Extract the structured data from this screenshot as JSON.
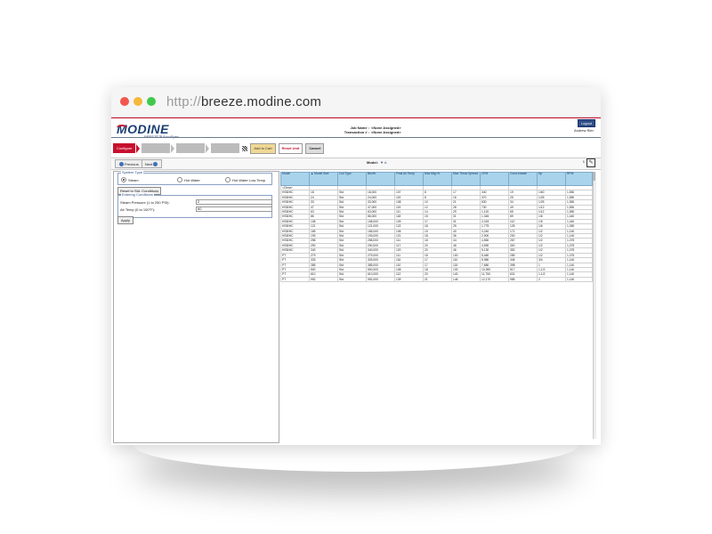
{
  "browser": {
    "url_protocol": "http://",
    "url_host": "breeze.modine.com"
  },
  "brand": {
    "name": "MODINE",
    "product": "BREEZE™ AccuSpec"
  },
  "job": {
    "job_name_label": "Job Name :",
    "job_name_value": "<None Assigned>",
    "transaction_label": "Transaction # :",
    "transaction_value": "<None Assigned>"
  },
  "header": {
    "logout_label": "Logout",
    "user_name": "Andrew Rier"
  },
  "steps": {
    "configure": "Configure",
    "cart": "Add to Cart",
    "reset": "Reset Unit",
    "cancel": "Cancel"
  },
  "nav": {
    "previous": "Previous",
    "next": "Next",
    "model_label": "Model:",
    "model_value": "▼ A",
    "page": "1"
  },
  "system_type": {
    "legend": "System Type",
    "options": [
      "Steam",
      "Hot Water",
      "Hot Water Low Temp"
    ],
    "selected": "Steam"
  },
  "reset_std_label": "Reset to Std. Conditions",
  "entering": {
    "legend": "Entering Conditions",
    "steam_pressure_label": "Steam Pressure (1 to 250 PSI):",
    "steam_pressure_value": "2",
    "air_temp_label": "Air Temp (0 to 100°F):",
    "air_temp_value": "60"
  },
  "apply_label": "Apply",
  "table": {
    "headers": [
      "Model",
      "▲ Model Size",
      "Coil Type",
      "Btu/Hr",
      "Final Air Temp",
      "Max Mtg Ht",
      "Max Throw Spread",
      "CFM",
      "Cond-ensate",
      "Hp",
      "RPM"
    ],
    "clear_label": "<Clear>",
    "rows": [
      [
        "HSB/HC",
        "18",
        "Std",
        "18,000",
        "107",
        "8",
        "17",
        "340",
        "19",
        "1/60",
        "1,550"
      ],
      [
        "HSB/HC",
        "24",
        "Std",
        "24,000",
        "119",
        "8",
        "16",
        "370",
        "25",
        "1/25",
        "1,550"
      ],
      [
        "HSB/HC",
        "33",
        "Std",
        "33,000",
        "108",
        "10",
        "21",
        "630",
        "34",
        "1/25",
        "1,550"
      ],
      [
        "HSB/HC",
        "47",
        "Std",
        "47,000",
        "119",
        "12",
        "28",
        "730",
        "49",
        "1/12",
        "1,550"
      ],
      [
        "HSB/HC",
        "63",
        "Std",
        "63,000",
        "111",
        "14",
        "29",
        "1,120",
        "65",
        "1/12",
        "1,550"
      ],
      [
        "HSB/HC",
        "86",
        "Std",
        "86,000",
        "118",
        "15",
        "31",
        "1,345",
        "89",
        "1/6",
        "1,440"
      ],
      [
        "HSB/HC",
        "108",
        "Std",
        "108,000",
        "109",
        "17",
        "31",
        "2,015",
        "112",
        "1/5",
        "1,440"
      ],
      [
        "HSB/HC",
        "121",
        "Std",
        "121,000",
        "122",
        "18",
        "25",
        "1,775",
        "125",
        "1/6",
        "1,050"
      ],
      [
        "HSB/HC",
        "165",
        "Std",
        "165,000",
        "106",
        "19",
        "40",
        "3,240",
        "171",
        "1/2",
        "1,140"
      ],
      [
        "HSB/HC",
        "193",
        "Std",
        "193,000",
        "121",
        "18",
        "36",
        "2,900",
        "200",
        "1/2",
        "1,140"
      ],
      [
        "HSB/HC",
        "258",
        "Std",
        "258,000",
        "111",
        "18",
        "44",
        "4,560",
        "267",
        "1/2",
        "1,075"
      ],
      [
        "HSB/HC",
        "290",
        "Std",
        "290,000",
        "117",
        "20",
        "46",
        "4,590",
        "300",
        "1/2",
        "1,075"
      ],
      [
        "HSB/HC",
        "340",
        "Std",
        "340,000",
        "120",
        "20",
        "46",
        "5,130",
        "352",
        "1/2",
        "1,075"
      ],
      [
        "PT",
        "279",
        "Std",
        "279,000",
        "111",
        "18",
        "100",
        "5,460",
        "289",
        "1/2",
        "1,075"
      ],
      [
        "PT",
        "333",
        "Std",
        "333,000",
        "116",
        "17",
        "110",
        "5,980",
        "345",
        "3/4",
        "1,140"
      ],
      [
        "PT",
        "385",
        "Std",
        "385,000",
        "110",
        "17",
        "115",
        "7,680",
        "398",
        "1",
        "1,140"
      ],
      [
        "PT",
        "500",
        "Std",
        "500,000",
        "108",
        "18",
        "130",
        "10,390",
        "517",
        "1-1/2",
        "1,140"
      ],
      [
        "PT",
        "610",
        "Std",
        "610,000",
        "112",
        "20",
        "140",
        "11,750",
        "631",
        "1-1/2",
        "1,140"
      ],
      [
        "PT",
        "952",
        "Std",
        "952,000",
        "139",
        "21",
        "145",
        "12,170",
        "985",
        "2",
        "1,140"
      ]
    ]
  },
  "colors": {
    "brand_red": "#c8102e",
    "brand_blue": "#1a3f73",
    "header_bg": "#a9d3ea"
  }
}
